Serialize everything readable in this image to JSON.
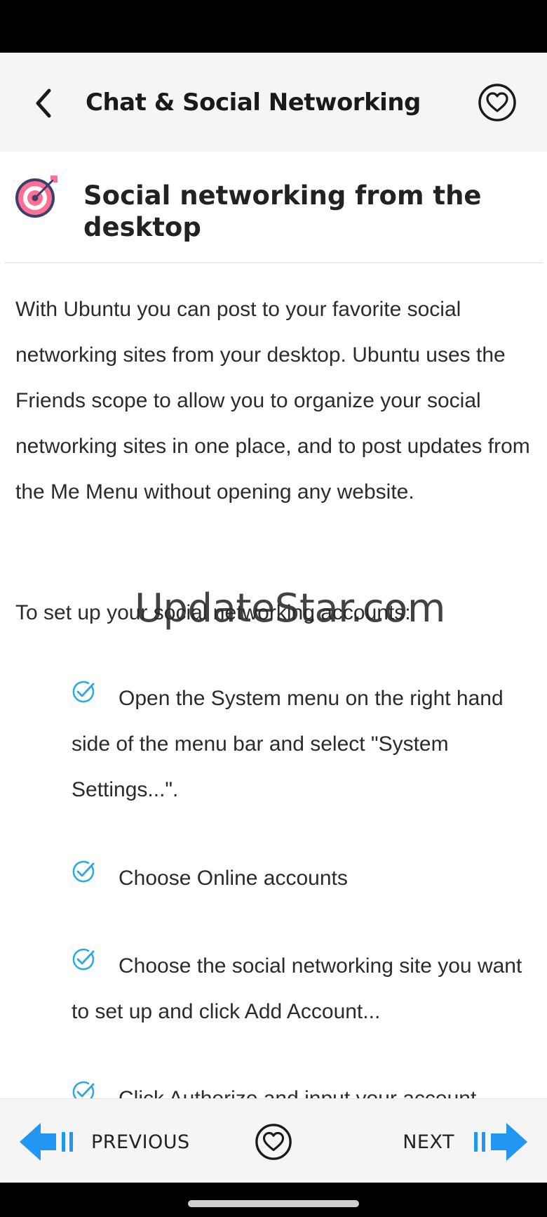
{
  "header": {
    "title": "Chat & Social Networking",
    "back_icon": "chevron-left-icon",
    "favorite_icon": "heart-circle-icon"
  },
  "article": {
    "icon": "target-icon",
    "title": "Social networking from the desktop",
    "intro": "With Ubuntu you can post to your favorite social networking sites from your desktop. Ubuntu uses the Friends scope to allow you to organize your social networking sites in one place, and to post updates from the Me Menu without opening any website.",
    "setup_label": "To set up your social networking accounts:",
    "steps": [
      {
        "text": "Open the System menu on the right hand side of the menu bar and select \"System Settings...\"."
      },
      {
        "text": "Choose Online accounts"
      },
      {
        "text": "Choose the social networking site you want to set up and click Add Account..."
      },
      {
        "text": "Click Authorize and input your account"
      }
    ]
  },
  "watermark": "UpdateStar.com",
  "footer": {
    "previous_label": "PREVIOUS",
    "next_label": "NEXT"
  },
  "colors": {
    "accent_blue": "#2196f3",
    "check_blue": "#29a9e0",
    "target_pink": "#ff6f91",
    "target_navy": "#3b3f6b"
  }
}
